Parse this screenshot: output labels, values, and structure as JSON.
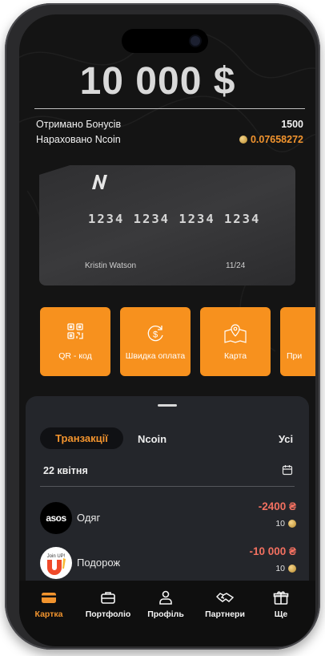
{
  "balance": {
    "amount": "10 000 $"
  },
  "bonuses": {
    "received_label": "Отримано Бонусів",
    "received_value": "1500",
    "ncoin_label": "Нараховано Ncoin",
    "ncoin_value": "0.07658272"
  },
  "card": {
    "number": "1234 1234 1234 1234",
    "holder": "Kristin Watson",
    "expiry": "11/24"
  },
  "actions": [
    {
      "label": "QR - код",
      "icon": "qr-code-icon"
    },
    {
      "label": "Швидка оплата",
      "icon": "fast-payment-icon"
    },
    {
      "label": "Карта",
      "icon": "map-icon"
    },
    {
      "label": "При",
      "icon": ""
    }
  ],
  "tabs": {
    "active": "Транзакції",
    "ncoin": "Ncoin",
    "all": "Усі"
  },
  "date_group": "22 квітня",
  "transactions": [
    {
      "logo_text": "asos",
      "category": "Одяг",
      "amount": "-2400 ₴",
      "coins": "10"
    },
    {
      "logo_text": "Join UP!",
      "category": "Подорож",
      "amount": "-10 000 ₴",
      "coins": "10"
    }
  ],
  "nav": [
    {
      "label": "Картка",
      "icon": "card-icon",
      "active": true
    },
    {
      "label": "Портфоліо",
      "icon": "briefcase-icon",
      "active": false
    },
    {
      "label": "Профіль",
      "icon": "user-icon",
      "active": false
    },
    {
      "label": "Партнери",
      "icon": "handshake-icon",
      "active": false
    },
    {
      "label": "Ще",
      "icon": "gift-icon",
      "active": false
    }
  ],
  "colors": {
    "accent": "#f7911e",
    "negative": "#f27060",
    "background": "#141414",
    "sheet": "#24262b"
  }
}
